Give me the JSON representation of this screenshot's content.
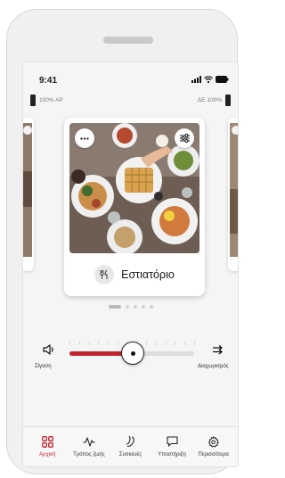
{
  "status": {
    "time": "9:41"
  },
  "battery": {
    "left_label": "100% ΑΡ",
    "right_label": "ΔΕ 100%"
  },
  "card": {
    "label": "Εστιατόριο",
    "icon": "restaurant-icon"
  },
  "carousel": {
    "pages": 5,
    "active_index": 0
  },
  "volume": {
    "mute_label": "Σίγαση",
    "split_label": "Διαχωρισμός",
    "level": 0.51
  },
  "tabs": [
    {
      "label": "Αρχική",
      "icon": "home-grid-icon",
      "active": true
    },
    {
      "label": "Τρόπος ζωής",
      "icon": "activity-icon",
      "active": false
    },
    {
      "label": "Συσκευές",
      "icon": "hearing-aid-icon",
      "active": false
    },
    {
      "label": "Υποστήριξη",
      "icon": "chat-icon",
      "active": false
    },
    {
      "label": "Περισσότερα",
      "icon": "gear-icon",
      "active": false
    }
  ],
  "colors": {
    "accent": "#c0252f",
    "track": "#dedede"
  }
}
